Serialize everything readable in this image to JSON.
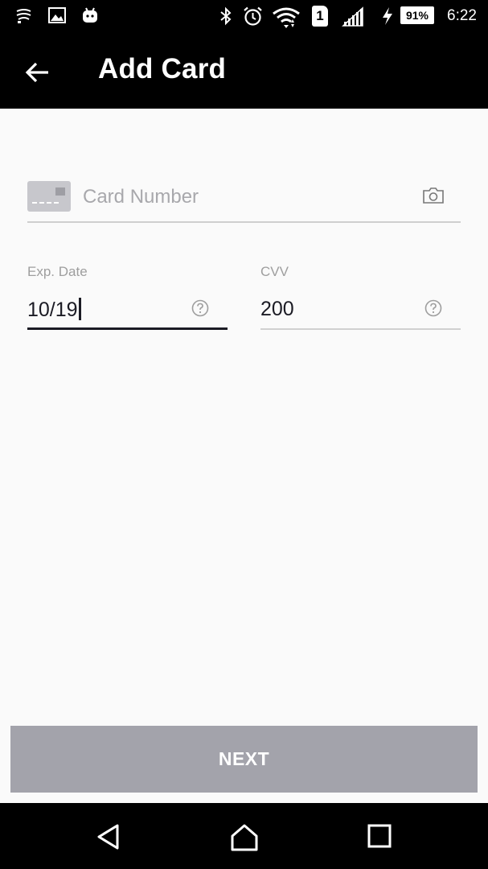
{
  "status_bar": {
    "time": "6:22",
    "battery": "91%",
    "sim_slot": "1",
    "left_icons": [
      "cast-icon",
      "image-icon",
      "android-icon"
    ],
    "right_icons": [
      "bluetooth-icon",
      "alarm-icon",
      "wifi-icon",
      "sim-icon",
      "signal-icon",
      "charging-icon",
      "battery-icon"
    ]
  },
  "app_bar": {
    "title": "Add Card",
    "back_icon": "arrow-left-icon"
  },
  "form": {
    "card_number": {
      "placeholder": "Card Number",
      "value": "",
      "icon": "credit-card-icon",
      "scan_icon": "camera-icon"
    },
    "exp_date": {
      "label": "Exp. Date",
      "value": "10/19",
      "help_icon": "question-circle-icon",
      "focused": true
    },
    "cvv": {
      "label": "CVV",
      "value": "200",
      "help_icon": "question-circle-icon"
    }
  },
  "next_button": {
    "label": "NEXT",
    "color": "#a3a3ab"
  },
  "nav_bar": {
    "icons": [
      "back-triangle-icon",
      "home-icon",
      "recents-icon"
    ]
  },
  "colors": {
    "app_bar_bg": "#000000",
    "background": "#fafafa",
    "text_primary": "#1b1b24",
    "text_hint": "#a8a8ac"
  }
}
